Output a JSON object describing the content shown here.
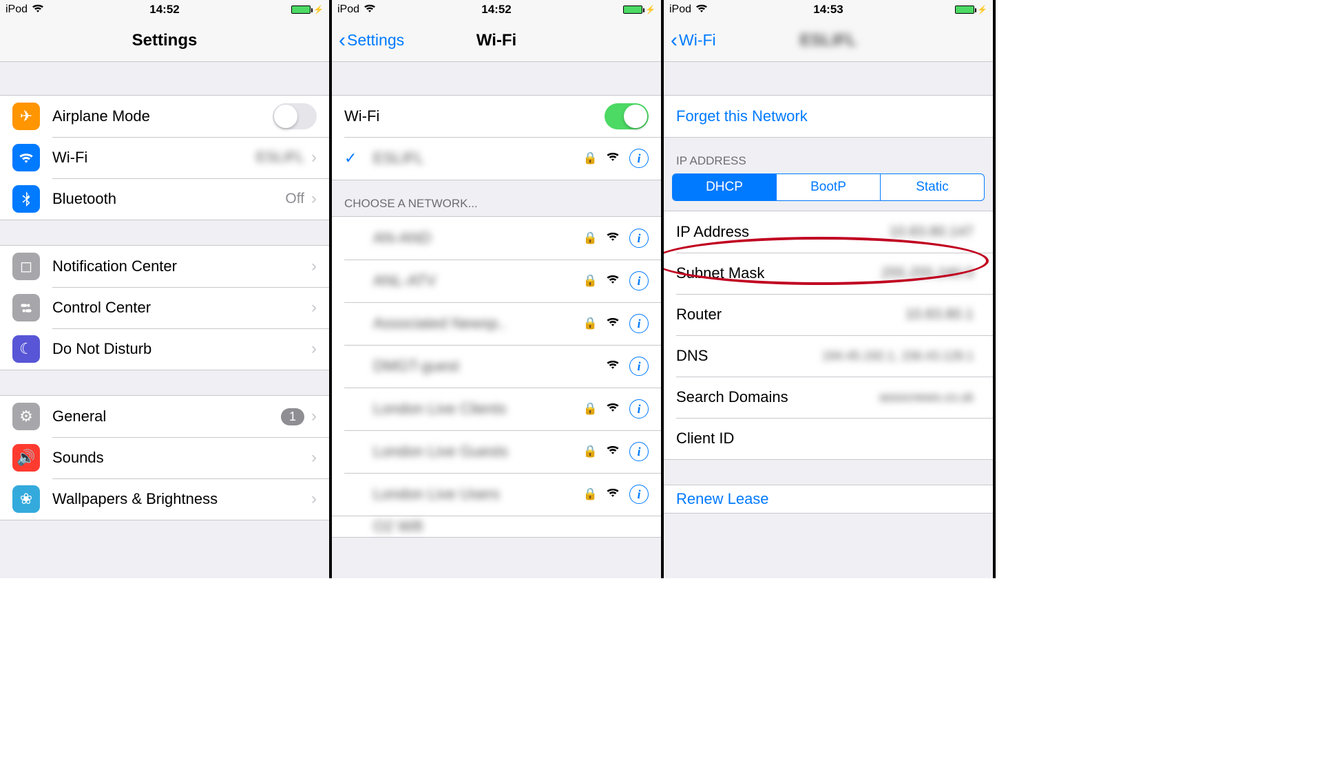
{
  "status": {
    "device": "iPod",
    "time1": "14:52",
    "time2": "14:52",
    "time3": "14:53"
  },
  "screen1": {
    "title": "Settings",
    "rows": {
      "airplane": "Airplane Mode",
      "wifi": "Wi-Fi",
      "wifi_value": "ESLIFL",
      "bluetooth": "Bluetooth",
      "bluetooth_value": "Off",
      "notif": "Notification Center",
      "control": "Control Center",
      "dnd": "Do Not Disturb",
      "general": "General",
      "general_badge": "1",
      "sounds": "Sounds",
      "wallpapers": "Wallpapers & Brightness"
    }
  },
  "screen2": {
    "back": "Settings",
    "title": "Wi-Fi",
    "wifi_label": "Wi-Fi",
    "current_net": "ESLIFL",
    "choose_header": "CHOOSE A NETWORK...",
    "nets": [
      {
        "name": "AN-AND",
        "locked": true
      },
      {
        "name": "ANL-ATV",
        "locked": true
      },
      {
        "name": "Associated Newsp..",
        "locked": true
      },
      {
        "name": "DMGT-guest",
        "locked": false
      },
      {
        "name": "London Live Clients",
        "locked": true
      },
      {
        "name": "London Live Guests",
        "locked": true
      },
      {
        "name": "London Live Users",
        "locked": true
      }
    ],
    "partial": "O2 Wifi"
  },
  "screen3": {
    "back": "Wi-Fi",
    "title": "ESLIFL",
    "forget": "Forget this Network",
    "ip_header": "IP ADDRESS",
    "seg": [
      "DHCP",
      "BootP",
      "Static"
    ],
    "rows": {
      "ip": "IP Address",
      "ip_v": "10.83.80.147",
      "subnet": "Subnet Mask",
      "subnet_v": "255.255.240.0",
      "router": "Router",
      "router_v": "10.83.80.1",
      "dns": "DNS",
      "dns_v": "194.45.192.1, 156.43.128.1",
      "search": "Search Domains",
      "search_v": "assocnews.co.uk",
      "client": "Client ID"
    },
    "renew": "Renew Lease"
  }
}
